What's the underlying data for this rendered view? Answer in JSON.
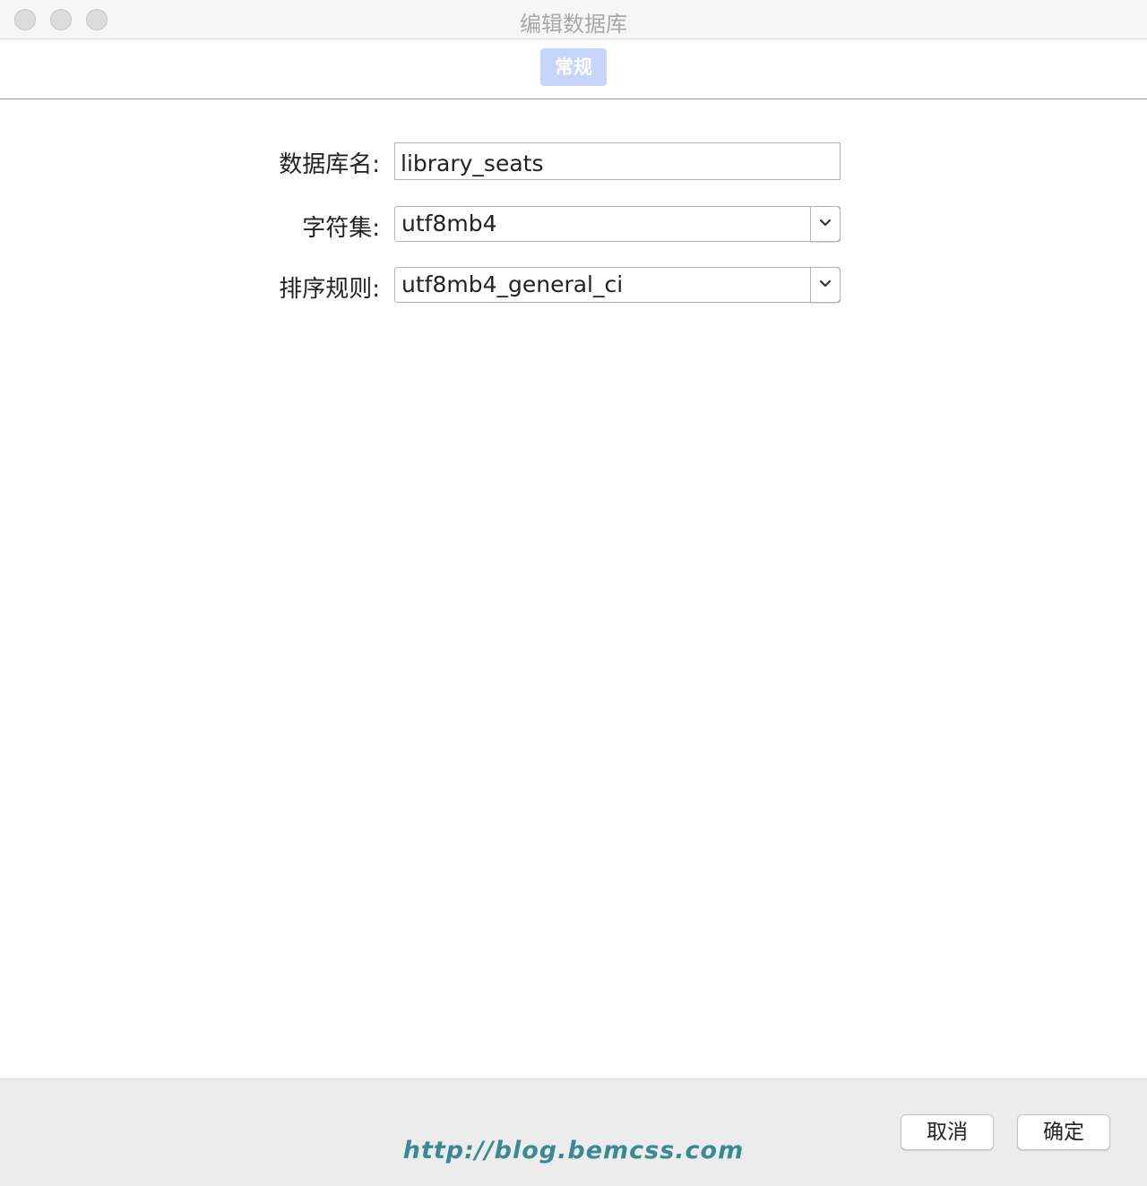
{
  "window": {
    "title": "编辑数据库"
  },
  "tabs": [
    {
      "label": "常规",
      "active": true
    }
  ],
  "form": {
    "name": {
      "label": "数据库名:",
      "value": "library_seats"
    },
    "charset": {
      "label": "字符集:",
      "value": "utf8mb4"
    },
    "collation": {
      "label": "排序规则:",
      "value": "utf8mb4_general_ci"
    }
  },
  "footer": {
    "watermark": "http://blog.bemcss.com",
    "cancel_label": "取消",
    "ok_label": "确定"
  },
  "colors": {
    "tab_active_bg": "#c7d5fb",
    "watermark": "#3a8a93",
    "footer_bg": "#ececec"
  },
  "icons": {
    "select_arrow": "chevron-down-icon"
  }
}
